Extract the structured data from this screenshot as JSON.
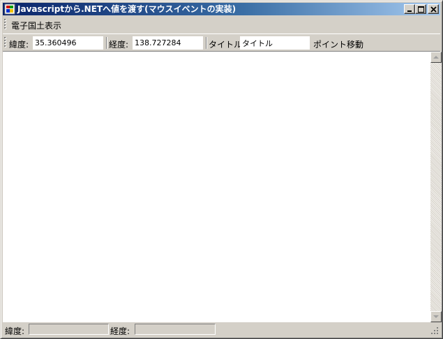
{
  "window": {
    "title": "Javascriptから.NETへ値を渡す(マウスイベントの実装)"
  },
  "menu": {
    "items": [
      {
        "label": "電子国土表示"
      }
    ]
  },
  "toolbar": {
    "latitude_label": "緯度:",
    "latitude_value": "35.360496",
    "longitude_label": "経度:",
    "longitude_value": "138.727284",
    "title_label": "タイトル:",
    "title_value": "タイトル",
    "move_button_label": "ポイント移動"
  },
  "status": {
    "latitude_label": "緯度:",
    "latitude_value": "",
    "longitude_label": "経度:",
    "longitude_value": ""
  },
  "icons": {
    "app": "windows-form-icon",
    "minimize": "minimize-icon",
    "maximize": "maximize-icon",
    "close": "close-icon",
    "scroll_up": "arrow-up-icon",
    "scroll_down": "arrow-down-icon",
    "grip": "grip-icon"
  },
  "colors": {
    "titlebar_start": "#0a246a",
    "titlebar_end": "#a6caf0",
    "face": "#d4d0c8"
  }
}
